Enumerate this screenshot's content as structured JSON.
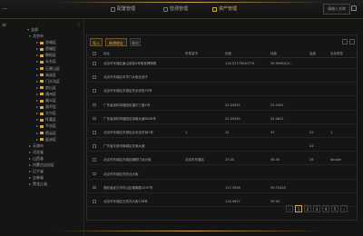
{
  "header": {
    "brand": "…",
    "nav": [
      "配置管理",
      "检测管理",
      "资产管理"
    ],
    "search_placeholder": "请输入名称"
  },
  "sidebar": {
    "root_label": "全部",
    "items": [
      {
        "label": "北京市",
        "depth": 1,
        "expanded": true
      },
      {
        "label": "东城区",
        "depth": 2
      },
      {
        "label": "西城区",
        "depth": 2
      },
      {
        "label": "朝阳区",
        "depth": 2
      },
      {
        "label": "丰台区",
        "depth": 2
      },
      {
        "label": "石景山区",
        "depth": 2
      },
      {
        "label": "海淀区",
        "depth": 2
      },
      {
        "label": "门头沟区",
        "depth": 2
      },
      {
        "label": "房山区",
        "depth": 2
      },
      {
        "label": "通州区",
        "depth": 2
      },
      {
        "label": "顺义区",
        "depth": 2
      },
      {
        "label": "昌平区",
        "depth": 2
      },
      {
        "label": "大兴区",
        "depth": 2
      },
      {
        "label": "怀柔区",
        "depth": 2
      },
      {
        "label": "平谷区",
        "depth": 2
      },
      {
        "label": "密云区",
        "depth": 2
      },
      {
        "label": "延庆区",
        "depth": 2
      },
      {
        "label": "天津市",
        "depth": 1
      },
      {
        "label": "河北省",
        "depth": 1
      },
      {
        "label": "山西省",
        "depth": 1
      },
      {
        "label": "内蒙古自治区",
        "depth": 1
      },
      {
        "label": "辽宁省",
        "depth": 1
      },
      {
        "label": "吉林省",
        "depth": 1
      },
      {
        "label": "黑龙江省",
        "depth": 1
      }
    ]
  },
  "toolbar": {
    "import": "导入",
    "add": "新增地址",
    "delete": "删除"
  },
  "table": {
    "headers": [
      "地址",
      "所属省市",
      "经度",
      "纬度",
      "高度",
      "坐标类型"
    ],
    "rows": [
      [
        "北京市东城区景山前街4号故宫博物院",
        "",
        "116.22776540774",
        "39.9996410...",
        "",
        ""
      ],
      [
        "北京市东城区东华门大街北池子",
        "",
        "",
        "",
        "",
        ""
      ],
      [
        "北京市东城区东城区东长安街33号",
        "",
        "",
        "",
        "",
        ""
      ],
      [
        "广东省深圳市福田区福中三路1号",
        "",
        "22.54555",
        "23.5452",
        "",
        ""
      ],
      [
        "广东省深圳市福田区深南大道6008号",
        "",
        "22.54545",
        "34.4612",
        "",
        ""
      ],
      [
        "北京市东城区东城区北京站东街1号",
        "1",
        "12",
        "33",
        "22",
        "1"
      ],
      [
        "广东省东莞市南城区东莞大道",
        "",
        "",
        "",
        "44",
        ""
      ],
      [
        "北京市东城区内城区朝阳门北大街",
        "北京市东城区",
        "23.45",
        "36.45",
        "26",
        "double"
      ],
      [
        "北京市东城区东四北大街",
        "",
        "",
        "",
        "",
        ""
      ],
      [
        "湖北省武汉市洪山区珞喻路1037号",
        "",
        "117.3556",
        "39.75426",
        "",
        ""
      ],
      [
        "北京市东城区王府井大街138号",
        "",
        "116.4637",
        "39.94",
        "",
        ""
      ]
    ]
  },
  "pagination": {
    "pages": [
      "1",
      "2",
      "3",
      "4",
      "5"
    ],
    "current": "1"
  }
}
